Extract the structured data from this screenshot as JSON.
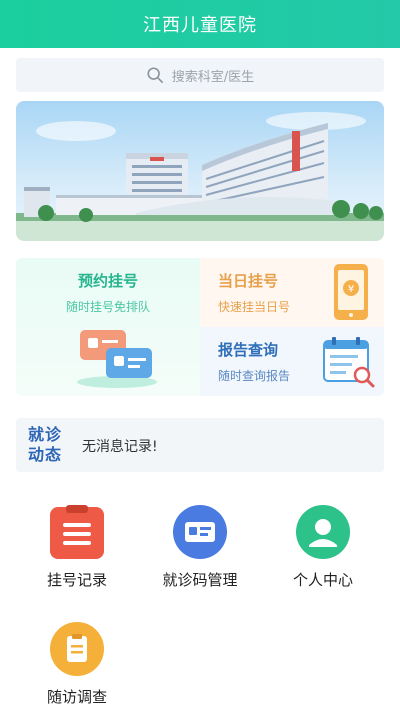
{
  "header": {
    "title": "江西儿童医院"
  },
  "search": {
    "placeholder": "搜索科室/医生"
  },
  "services": {
    "appointment": {
      "title": "预约挂号",
      "subtitle": "随时挂号免排队"
    },
    "same_day": {
      "title": "当日挂号",
      "subtitle": "快速挂当日号"
    },
    "report": {
      "title": "报告查询",
      "subtitle": "随时查询报告"
    }
  },
  "news": {
    "logo_line1": "就诊",
    "logo_line2": "动态",
    "message": "无消息记录!"
  },
  "menu": [
    {
      "label": "挂号记录",
      "icon": "clipboard-icon",
      "color": "#ee5a45"
    },
    {
      "label": "就诊码管理",
      "icon": "card-icon",
      "color": "#4a7be0"
    },
    {
      "label": "个人中心",
      "icon": "user-icon",
      "color": "#2cc28a"
    },
    {
      "label": "随访调查",
      "icon": "survey-icon",
      "color": "#f5b03a"
    }
  ],
  "colors": {
    "header": "#1ccf9e",
    "accent_green": "#26b58e",
    "accent_orange": "#e8a04b",
    "accent_blue": "#2f6fb8"
  }
}
